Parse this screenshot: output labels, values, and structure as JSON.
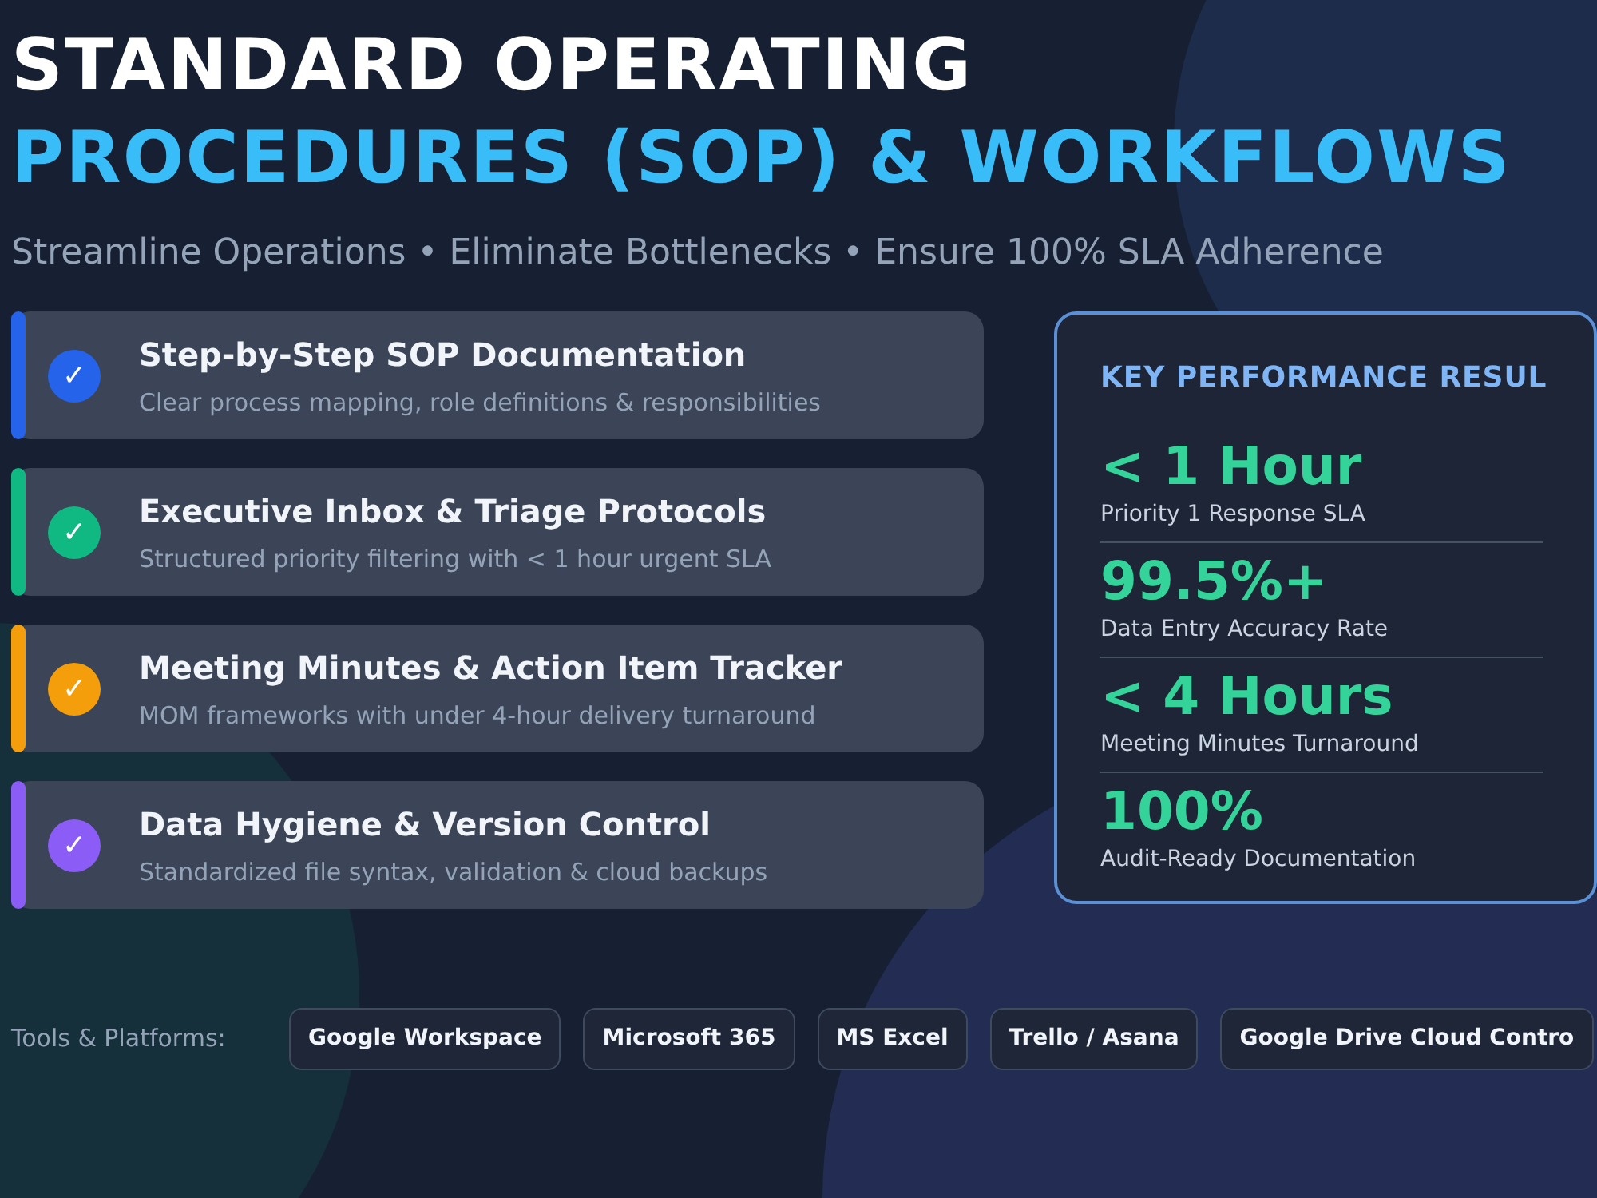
{
  "title": {
    "line_1": "STANDARD OPERATING",
    "line_2": "PROCEDURES (SOP) & WORKFLOWS"
  },
  "subtitle": "Streamline Operations • Eliminate Bottlenecks • Ensure 100% SLA Adherence",
  "features": [
    {
      "title": "Step-by-Step SOP Documentation",
      "description": "Clear process mapping, role definitions & responsibilities",
      "color": "#2563eb",
      "icon": "✓"
    },
    {
      "title": "Executive Inbox & Triage Protocols",
      "description": "Structured priority filtering with < 1 hour urgent SLA",
      "color": "#10b981",
      "icon": "✓"
    },
    {
      "title": "Meeting Minutes & Action Item Tracker",
      "description": "MOM frameworks with under 4-hour delivery turnaround",
      "color": "#f59e0b",
      "icon": "✓"
    },
    {
      "title": "Data Hygiene & Version Control",
      "description": "Standardized file syntax, validation & cloud backups",
      "color": "#8b5cf6",
      "icon": "✓"
    }
  ],
  "results": {
    "title": "KEY PERFORMANCE RESUL",
    "metrics": [
      {
        "value": "< 1 Hour",
        "label": "Priority 1 Response SLA"
      },
      {
        "value": "99.5%+",
        "label": "Data Entry Accuracy Rate"
      },
      {
        "value": "< 4 Hours",
        "label": "Meeting Minutes Turnaround"
      },
      {
        "value": "100%",
        "label": "Audit-Ready Documentation"
      }
    ]
  },
  "tools": {
    "label": "Tools & Platforms:",
    "items": [
      "Google Workspace",
      "Microsoft 365",
      "MS Excel",
      "Trello / Asana",
      "Google Drive Cloud Contro"
    ]
  }
}
